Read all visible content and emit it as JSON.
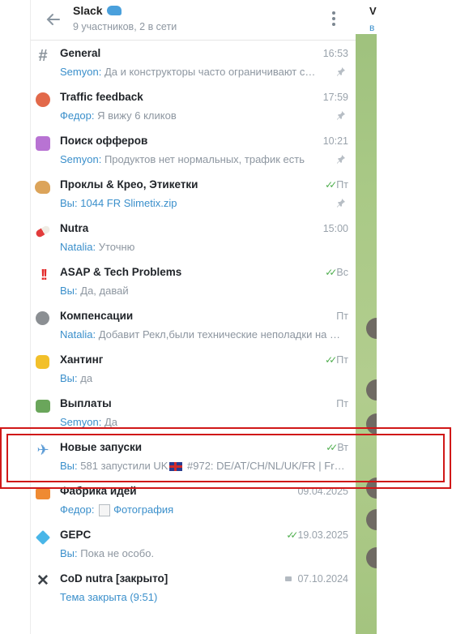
{
  "header": {
    "title": "Slack",
    "subtitle": "9 участников, 2 в сети"
  },
  "chats": [
    {
      "icon": "hash-icon",
      "name": "General",
      "time": "16:53",
      "sender": "Semyon:",
      "text": "Да и конструкторы часто ограничивают с…",
      "pinned": true
    },
    {
      "icon": "alarm-clock-icon",
      "name": "Traffic feedback",
      "time": "17:59",
      "sender": "Федор:",
      "text": "Я вижу 6 кликов",
      "pinned": true
    },
    {
      "icon": "unicorn-icon",
      "name": "Поиск офферов",
      "time": "10:21",
      "sender": "Semyon:",
      "text": "Продуктов нет нормальных, трафик есть",
      "pinned": true
    },
    {
      "icon": "palette-icon",
      "name": "Проклы & Крео, Этикетки",
      "time": "Пт",
      "read": true,
      "sender": "Вы:",
      "text": "1044 FR  Slimetix.zip",
      "text_link": true,
      "pinned": true
    },
    {
      "icon": "pill-icon",
      "name": "Nutra",
      "time": "15:00",
      "sender": "Natalia:",
      "text": "Уточню"
    },
    {
      "icon": "double-exclamation-icon",
      "name": "ASAP & Tech Problems",
      "time": "Вс",
      "read": true,
      "sender": "Вы:",
      "text": "Да, давай"
    },
    {
      "icon": "moon-icon",
      "name": "Компенсации",
      "time": "Пт",
      "sender": "Natalia:",
      "text": "Добавит Рекл,были технические неполадки на …"
    },
    {
      "icon": "waving-hand-icon",
      "name": "Хантинг",
      "time": "Пт",
      "read": true,
      "sender": "Вы:",
      "text": "да"
    },
    {
      "icon": "money-icon",
      "name": "Выплаты",
      "time": "Пт",
      "sender": "Semyon:",
      "text": "Да"
    },
    {
      "icon": "airplane-icon",
      "name": "Новые запуски",
      "time": "Вт",
      "read": true,
      "sender": "Вы:",
      "text_before": "581 запустили UK",
      "text_after": " #972: DE/AT/CH/NL/UK/FR | Fra…"
    },
    {
      "icon": "fox-icon",
      "name": "Фабрика идей",
      "time": "09.04.2025",
      "sender": "Федор:",
      "text": "Фотография",
      "text_link": true,
      "has_doc": true
    },
    {
      "icon": "gem-icon",
      "name": "GEPC",
      "time": "19.03.2025",
      "read": true,
      "sender": "Вы:",
      "text": "Пока не особо."
    },
    {
      "icon": "x-icon",
      "name": "CoD nutra [закрыто]",
      "time": "07.10.2024",
      "locked": true,
      "text": "Тема закрыта (9:51)",
      "text_link": true
    }
  ],
  "right_panel": {
    "title_letter": "V",
    "subtitle_letter": "в"
  },
  "colors": {
    "accent": "#3a8fcb",
    "read_check": "#4fae4e",
    "highlight": "#d01818",
    "chat_background": "#a9c986"
  }
}
